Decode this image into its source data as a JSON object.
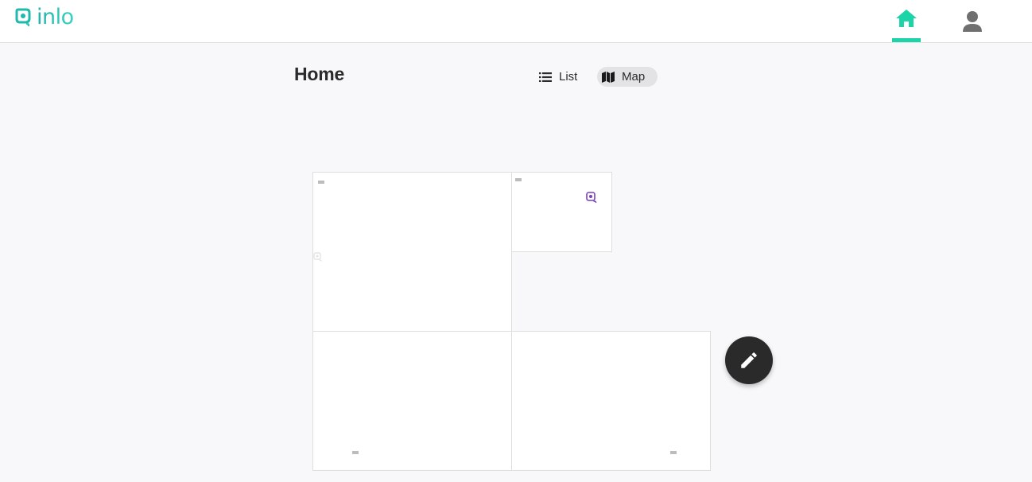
{
  "app": {
    "logo_text": "inlo"
  },
  "nav": {
    "home_icon": "home-icon",
    "profile_icon": "person-icon",
    "active": "home",
    "accent_color": "#1dd3a8"
  },
  "main": {
    "title": "Home",
    "view_toggle": {
      "list_label": "List",
      "map_label": "Map",
      "selected": "Map"
    }
  },
  "map": {
    "tile_style": "white tiles with light grey borders",
    "marker_icon": "location-marker-icon",
    "marker_color": "#7b3fbf"
  },
  "fab": {
    "icon": "pencil-icon"
  }
}
